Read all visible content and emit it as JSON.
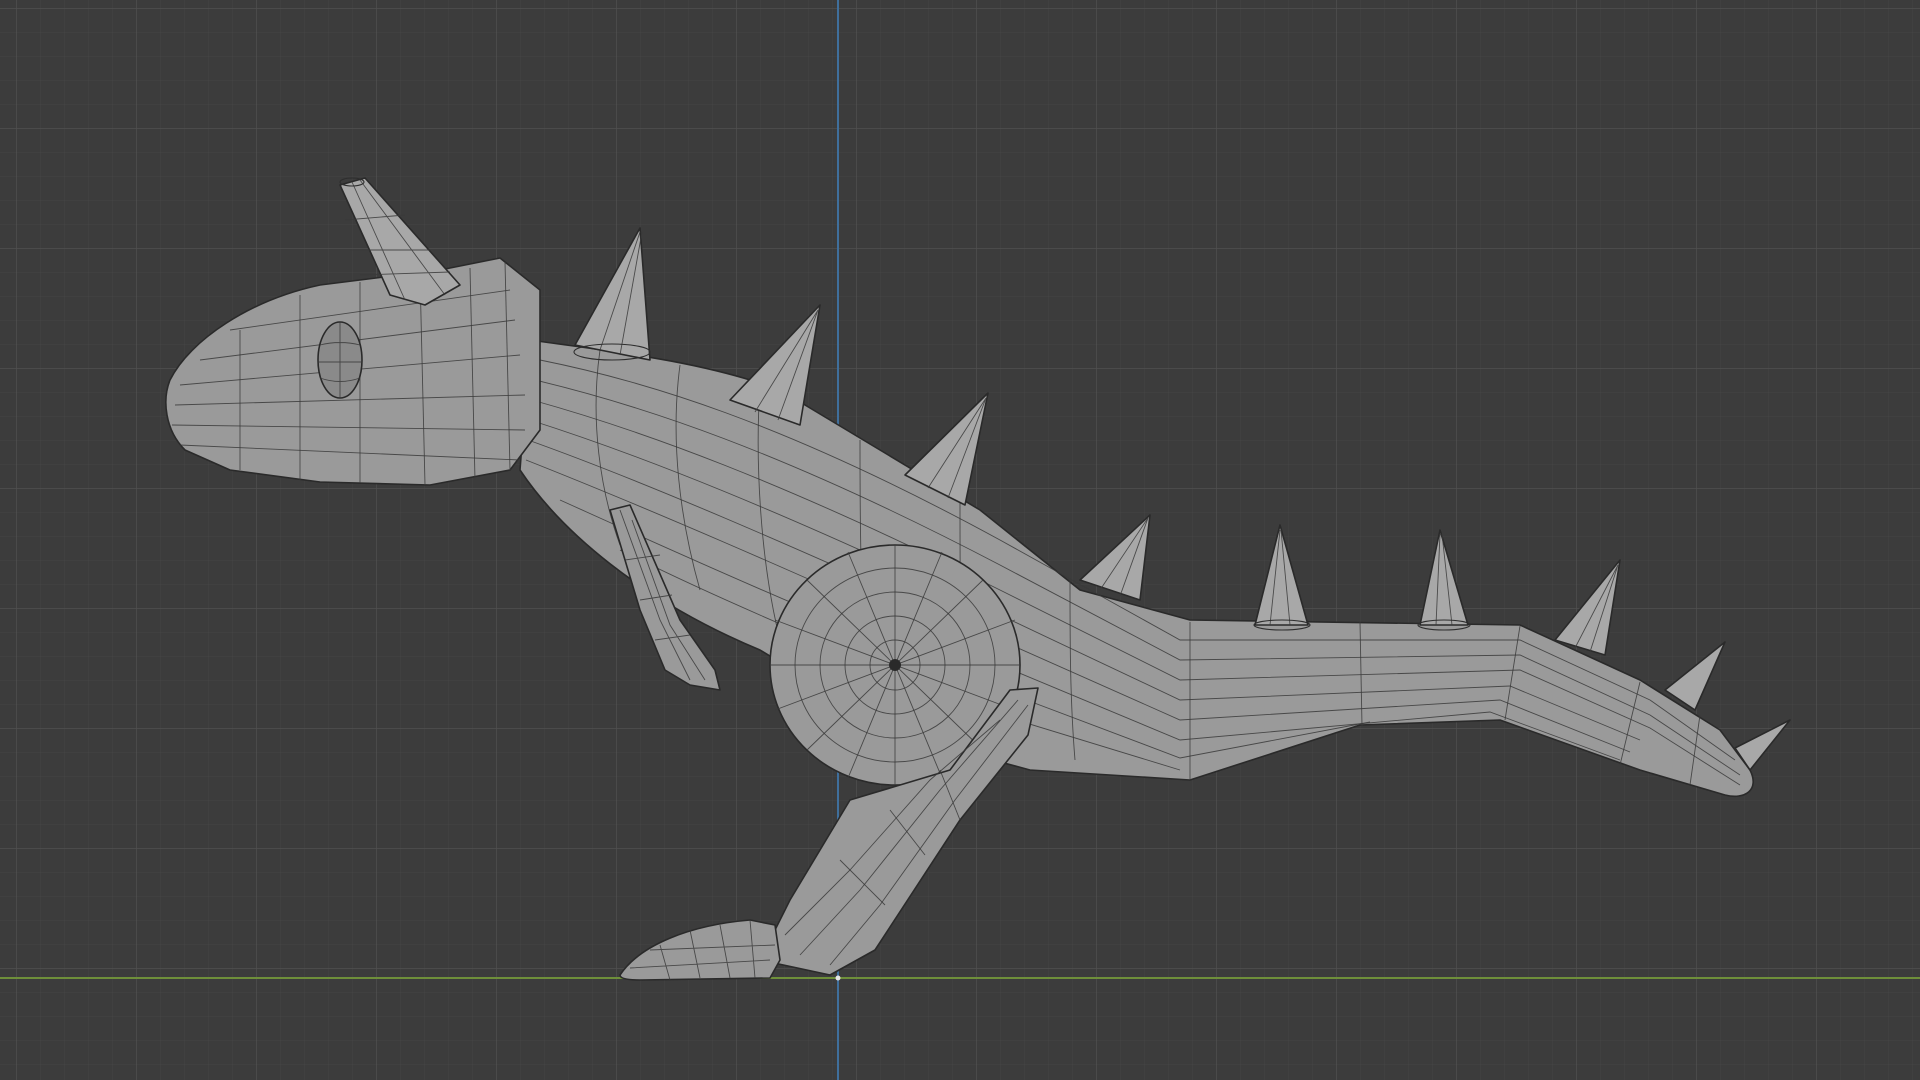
{
  "viewport": {
    "background_color": "#3c3c3c",
    "grid_minor_color": "#444444",
    "grid_major_color": "#4c4c4c",
    "x_axis_color": "#6e8f3a",
    "z_axis_color": "#3f6f9c",
    "mesh_color": "#9e9e9e",
    "wire_color": "#2e2e2e"
  },
  "model": {
    "description_icon": "dinosaur-mesh-icon"
  }
}
